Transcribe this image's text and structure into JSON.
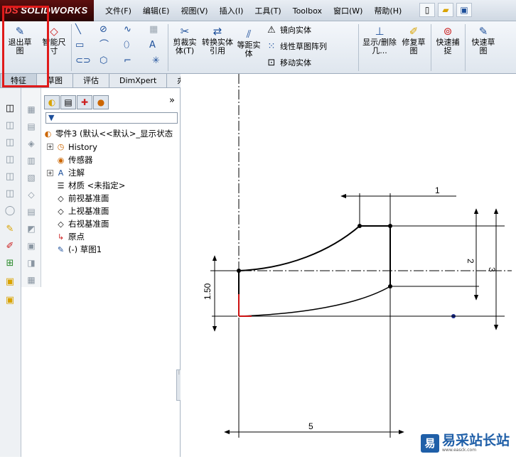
{
  "app": {
    "logo_ds": "DS",
    "logo_text": "SOLIDWORKS"
  },
  "menu": [
    "文件(F)",
    "编辑(E)",
    "视图(V)",
    "插入(I)",
    "工具(T)",
    "Toolbox",
    "窗口(W)",
    "帮助(H)"
  ],
  "ribbon": {
    "exit_sketch": "退出草图",
    "smart_dim": "智能尺寸",
    "trim": "剪裁实体(T)",
    "convert": "转换实体引用",
    "offset": "等距实体",
    "mirror": "镜向实体",
    "linear_array": "线性草图阵列",
    "move": "移动实体",
    "display_delete": "显示/删除几...",
    "repair": "修复草图",
    "quick_snap": "快速捕捉",
    "rapid_sketch": "快速草图"
  },
  "tabs": [
    "特征",
    "草图",
    "评估",
    "DimXpert",
    "办公室产品"
  ],
  "tree": {
    "filter_icon": "filter-icon",
    "root": "零件3 (默认<<默认>_显示状态",
    "items": [
      "History",
      "传感器",
      "注解",
      "材质 <未指定>",
      "前视基准面",
      "上视基准面",
      "右视基准面",
      "原点",
      "(-) 草图1"
    ]
  },
  "dimensions": {
    "d1": "1",
    "d2": "2",
    "d3": "3",
    "d150": "1.50",
    "d5": "5"
  },
  "watermark": {
    "logo": "易",
    "title": "易采站长站",
    "sub": "www.easck.com"
  }
}
